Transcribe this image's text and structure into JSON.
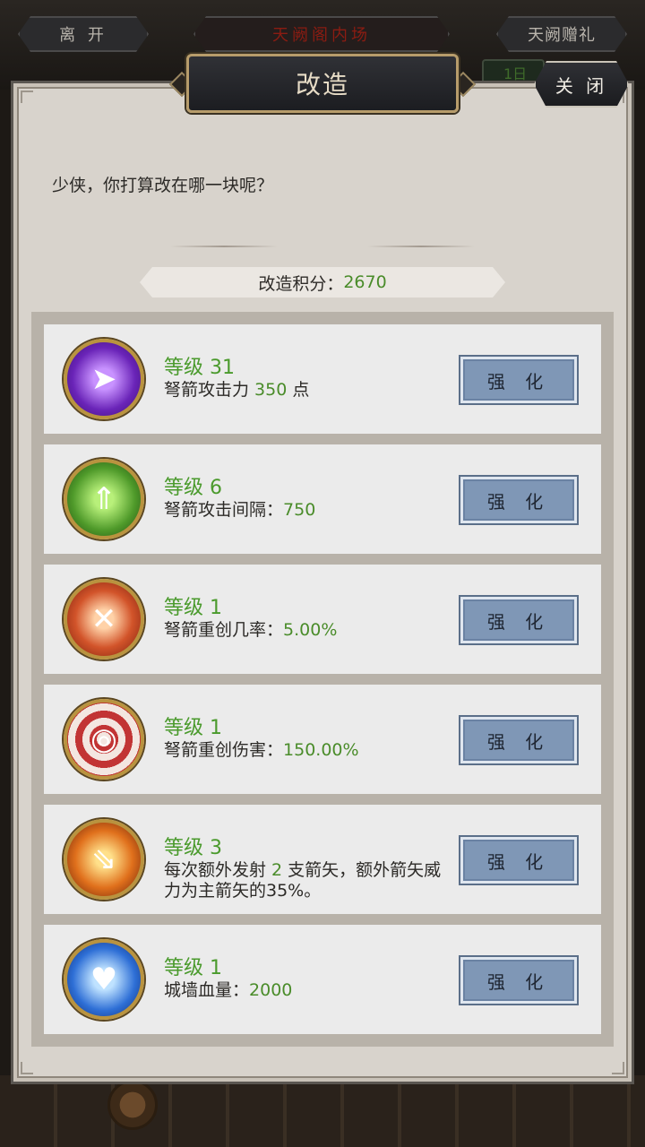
{
  "background": {
    "leave_label": "离 开",
    "scene_title": "天阙阁内场",
    "gift_label": "天阙赠礼",
    "date_peek": "1日"
  },
  "dialog": {
    "title": "改造",
    "close_label": "关 闭",
    "prompt": "少侠，你打算改在哪一块呢？",
    "points_label": "改造积分：",
    "points_value": "2670"
  },
  "upgrades": [
    {
      "level": "等级 31",
      "desc_prefix": "弩箭攻击力 ",
      "value": "350",
      "desc_suffix": " 点",
      "button": "强 化",
      "icon": "purple-arrow-icon",
      "color": "#7a3cc8"
    },
    {
      "level": "等级 6",
      "desc_prefix": "弩箭攻击间隔：",
      "value": "750",
      "desc_suffix": "",
      "button": "强 化",
      "icon": "green-bow-icon",
      "color": "#4f9a2a"
    },
    {
      "level": "等级 1",
      "desc_prefix": "弩箭重创几率：",
      "value": "5.00%",
      "desc_suffix": "",
      "button": "强 化",
      "icon": "red-crossbow-icon",
      "color": "#c8472a"
    },
    {
      "level": "等级 1",
      "desc_prefix": "弩箭重创伤害：",
      "value": "150.00%",
      "desc_suffix": "",
      "button": "强 化",
      "icon": "target-arrow-icon",
      "color": "#c23434"
    },
    {
      "level": "等级 3",
      "desc_prefix": "每次额外发射 ",
      "value": "2",
      "desc_suffix": " 支箭矢，额外箭矢威力为主箭矢的35%。",
      "button": "强 化",
      "icon": "fire-arrows-icon",
      "color": "#d2721c"
    },
    {
      "level": "等级 1",
      "desc_prefix": "城墙血量：",
      "value": "2000",
      "desc_suffix": "",
      "button": "强 化",
      "icon": "heart-shield-icon",
      "color": "#2e6fd6"
    }
  ]
}
